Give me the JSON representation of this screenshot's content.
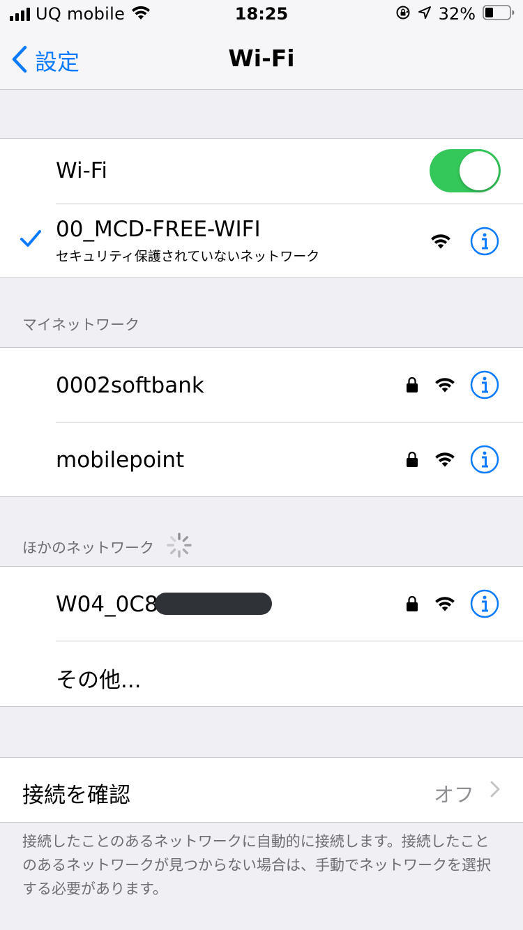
{
  "status_bar": {
    "carrier": "UQ mobile",
    "time": "18:25",
    "battery_percent": "32%",
    "icons": [
      "signal-bars-icon",
      "wifi-icon",
      "orientation-lock-icon",
      "location-arrow-icon",
      "battery-icon"
    ]
  },
  "nav": {
    "back_label": "設定",
    "title": "Wi-Fi"
  },
  "wifi_toggle": {
    "label": "Wi-Fi",
    "state": "on"
  },
  "connected_network": {
    "name": "00_MCD-FREE-WIFI",
    "subtitle": "セキュリティ保護されていないネットワーク",
    "secured": false
  },
  "my_networks": {
    "header": "マイネットワーク",
    "items": [
      {
        "name": "0002softbank",
        "secured": true
      },
      {
        "name": "mobilepoint",
        "secured": true
      }
    ]
  },
  "other_networks": {
    "header": "ほかのネットワーク",
    "items": [
      {
        "name": "W04_0C8",
        "secured": true,
        "redacted_suffix": true
      }
    ],
    "other_label": "その他..."
  },
  "ask_to_join": {
    "label": "接続を確認",
    "value": "オフ",
    "description": "接続したことのあるネットワークに自動的に接続します。接続したことのあるネットワークが見つからない場合は、手動でネットワークを選択する必要があります。"
  },
  "colors": {
    "accent": "#0a7aff",
    "toggle_on": "#34c759",
    "background": "#efeff4",
    "secondary_text": "#6d6d72"
  }
}
